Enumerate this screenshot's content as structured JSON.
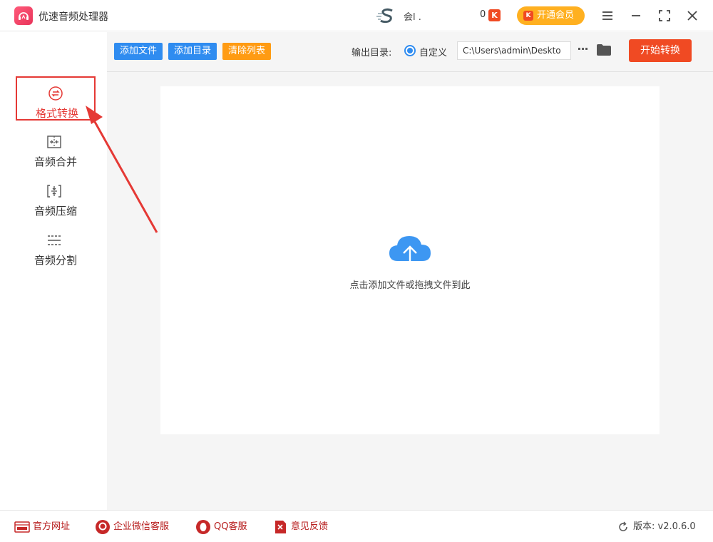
{
  "app": {
    "title": "优速音频处理器"
  },
  "titlebar": {
    "user_name": "会l .",
    "coin_count": "0",
    "coin_badge": "K",
    "vip_label": "开通会员",
    "icons": [
      "menu-icon",
      "minimize-icon",
      "maximize-icon",
      "close-icon"
    ]
  },
  "sidebar": {
    "items": [
      {
        "label": "格式转换",
        "icon": "format-convert-icon",
        "active": true
      },
      {
        "label": "音频合并",
        "icon": "audio-merge-icon",
        "active": false
      },
      {
        "label": "音频压缩",
        "icon": "audio-compress-icon",
        "active": false
      },
      {
        "label": "音频分割",
        "icon": "audio-split-icon",
        "active": false
      }
    ]
  },
  "toolbar": {
    "add_file": "添加文件",
    "add_folder": "添加目录",
    "clear_list": "清除列表",
    "output_label": "输出目录:",
    "custom_option": "自定义",
    "output_path": "C:\\Users\\admin\\Deskto",
    "more": "···",
    "start": "开始转换"
  },
  "main": {
    "drop_hint": "点击添加文件或拖拽文件到此"
  },
  "footer": {
    "website": "官方网址",
    "wechat": "企业微信客服",
    "qq": "QQ客服",
    "feedback": "意见反馈",
    "version": "版本: v2.0.6.0"
  },
  "colors": {
    "accent": "#2f8cf0",
    "danger": "#f04a23",
    "orange": "#ff9b13",
    "vip": "#ffb020",
    "highlight": "#e53935"
  }
}
